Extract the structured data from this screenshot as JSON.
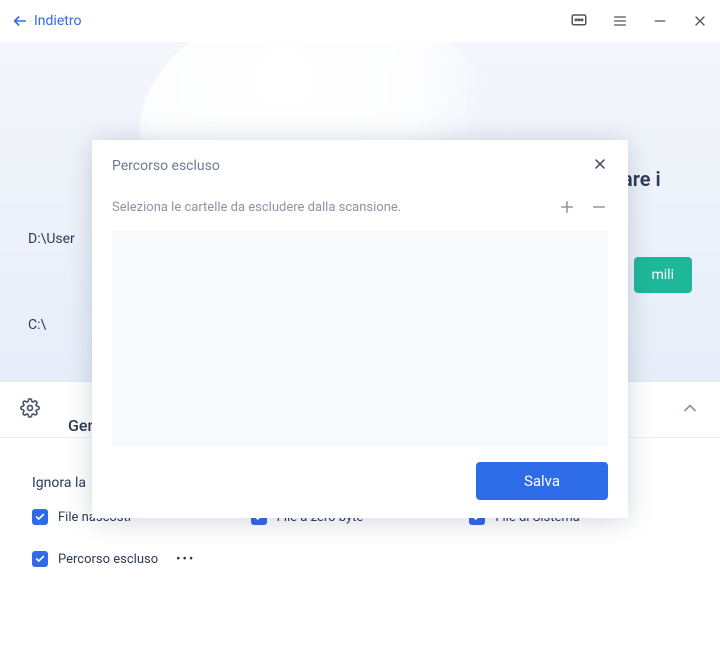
{
  "titlebar": {
    "back_label": "Indietro"
  },
  "hero": {
    "title": "Clicca sul pulsante per trovare i",
    "button_fragment": "mili",
    "paths": [
      "D:\\User",
      "C:\\"
    ]
  },
  "settings": {
    "tab_label": "Gene",
    "ignore_label": "Ignora la",
    "check_hidden": "File nascosti",
    "check_zero": "File a zero byte",
    "check_system": "File di Sistema",
    "check_excluded": "Percorso escluso"
  },
  "modal": {
    "title": "Percorso escluso",
    "subtitle": "Seleziona le cartelle da escludere dalla scansione.",
    "save_label": "Salva"
  }
}
